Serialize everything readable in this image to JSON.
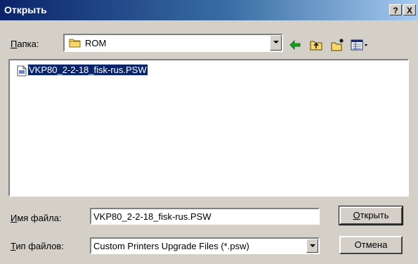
{
  "window": {
    "title": "Открыть",
    "help_label": "?",
    "close_label": "X"
  },
  "lookin": {
    "label_u": "П",
    "label_rest": "апка:",
    "value": "ROM",
    "icon": "folder-icon"
  },
  "toolbar": {
    "icons": [
      "back-arrow-icon",
      "up-folder-icon",
      "new-folder-icon",
      "view-menu-icon"
    ]
  },
  "files": [
    {
      "name": "VKP80_2-2-18_fisk-rus.PSW",
      "selected": true,
      "icon": "file-icon"
    }
  ],
  "filename": {
    "label_u": "И",
    "label_rest": "мя файла:",
    "value": "VKP80_2-2-18_fisk-rus.PSW"
  },
  "filetype": {
    "label_u": "Т",
    "label_rest": "ип файлов:",
    "value": "Custom Printers Upgrade Files (*.psw)"
  },
  "buttons": {
    "open_u": "О",
    "open_rest": "ткрыть",
    "cancel": "Отмена"
  },
  "colors": {
    "title_start": "#0a246a",
    "title_end": "#a6caf0",
    "face": "#d4d0c8",
    "selection": "#0a246a"
  }
}
